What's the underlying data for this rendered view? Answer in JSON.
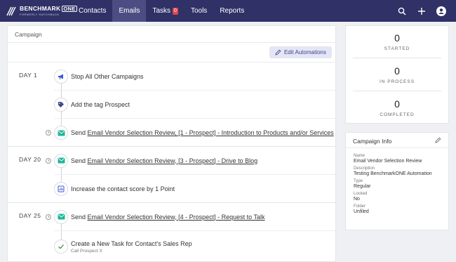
{
  "brand": {
    "name": "BENCHMARK",
    "one": "ONE",
    "subtitle": "FORMERLY HATCHBUCK"
  },
  "nav": {
    "contacts": "Contacts",
    "emails": "Emails",
    "tasks": "Tasks",
    "tasks_count": "0",
    "tools": "Tools",
    "reports": "Reports"
  },
  "main": {
    "title": "Campaign",
    "edit_label": "Edit Automations",
    "days": [
      {
        "label": "DAY 1",
        "steps": [
          {
            "text": "Stop All Other Campaigns"
          },
          {
            "text": "Add the tag Prospect"
          },
          {
            "prefix": "Send",
            "link": "Email Vendor Selection Review, [1 - Prospect] - Introduction to Products and/or Services"
          }
        ]
      },
      {
        "label": "DAY 20",
        "steps": [
          {
            "prefix": "Send",
            "link": "Email Vendor Selection Review, [3 - Prospect] - Drive to Blog"
          },
          {
            "text": "Increase the contact score by 1 Point"
          }
        ]
      },
      {
        "label": "DAY 25",
        "steps": [
          {
            "prefix": "Send",
            "link": "Email Vendor Selection Review, [4 - Prospect] - Request to Talk"
          },
          {
            "text": "Create a New Task for Contact's Sales Rep",
            "sub": "Call Prospect X"
          }
        ]
      }
    ]
  },
  "stats": [
    {
      "value": "0",
      "label": "STARTED"
    },
    {
      "value": "0",
      "label": "IN PROCESS"
    },
    {
      "value": "0",
      "label": "COMPLETED"
    }
  ],
  "info": {
    "title": "Campaign Info",
    "fields": [
      {
        "key": "Name",
        "value": "Email Vendor Selection Review"
      },
      {
        "key": "Description",
        "value": "Testing BenchmarkONE Automation"
      },
      {
        "key": "Type",
        "value": "Regular"
      },
      {
        "key": "Locked",
        "value": "No"
      },
      {
        "key": "Folder",
        "value": "Unfiled"
      }
    ]
  },
  "colors": {
    "nav_bg": "#2f3167",
    "nav_active": "#4c4e83",
    "accent": "#3d4190",
    "email_icon": "#1fb59a",
    "badge": "#e0474b"
  }
}
